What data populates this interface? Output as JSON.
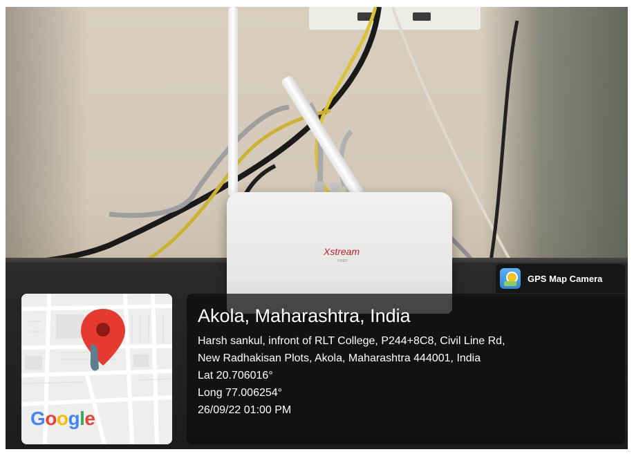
{
  "photo": {
    "router_brand": "Xstream",
    "router_sub": "FIBER"
  },
  "map": {
    "logo_text": "Google",
    "icons": [
      "map-pin-icon",
      "street-map"
    ],
    "logo_colors": [
      "#4285F4",
      "#EA4335",
      "#FBBC05",
      "#4285F4",
      "#34A853",
      "#EA4335"
    ]
  },
  "app": {
    "name": "GPS Map Camera",
    "icon": "gps-map-camera-icon"
  },
  "location": {
    "title": "Akola, Maharashtra, India",
    "address_line1": "Harsh sankul, infront of RLT College, P244+8C8, Civil Line Rd,",
    "address_line2": "New Radhakisan Plots, Akola, Maharashtra 444001, India",
    "lat": "Lat 20.706016°",
    "long": "Long 77.006254°",
    "datetime": "26/09/22 01:00 PM"
  }
}
